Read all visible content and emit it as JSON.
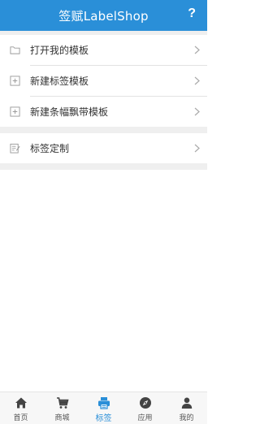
{
  "header": {
    "title": "签赋LabelShop",
    "help": "?"
  },
  "menu": {
    "items": [
      {
        "label": "打开我的模板",
        "icon": "folder-icon"
      },
      {
        "label": "新建标签模板",
        "icon": "add-box-icon"
      },
      {
        "label": "新建条幅飘带模板",
        "icon": "add-box-icon"
      },
      {
        "label": "标签定制",
        "icon": "edit-note-icon"
      }
    ]
  },
  "tabbar": {
    "active": "标签",
    "tabs": [
      {
        "label": "首页",
        "icon": "home-icon"
      },
      {
        "label": "商城",
        "icon": "cart-icon"
      },
      {
        "label": "标签",
        "icon": "printer-icon"
      },
      {
        "label": "应用",
        "icon": "compass-icon"
      },
      {
        "label": "我的",
        "icon": "user-icon"
      }
    ]
  },
  "colors": {
    "accent": "#2a8fd8",
    "separator": "#efefef",
    "text": "#333333"
  }
}
